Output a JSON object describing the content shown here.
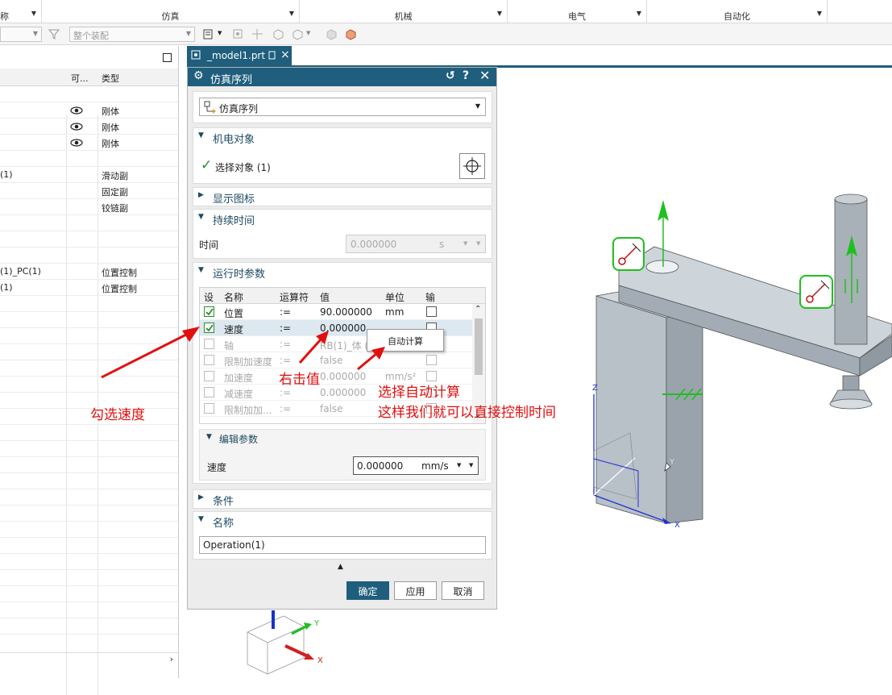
{
  "ribbon": {
    "groups": [
      {
        "label": "仿真"
      },
      {
        "label": "机械"
      },
      {
        "label": "电气"
      },
      {
        "label": "自动化"
      }
    ],
    "left_fragment": "称"
  },
  "toolbar": {
    "combo_left_value": "",
    "assembly_combo": "整个装配"
  },
  "navigator": {
    "columns": [
      "可...",
      "类型"
    ],
    "rows": [
      {
        "name": "",
        "visible": false,
        "type": ""
      },
      {
        "name": "",
        "visible": true,
        "type": "刚体"
      },
      {
        "name": "",
        "visible": true,
        "type": "刚体"
      },
      {
        "name": "",
        "visible": true,
        "type": "刚体"
      },
      {
        "name": "",
        "visible": false,
        "type": ""
      },
      {
        "name": "(1)",
        "visible": false,
        "type": "滑动副"
      },
      {
        "name": "",
        "visible": false,
        "type": "固定副"
      },
      {
        "name": "",
        "visible": false,
        "type": "铰链副"
      },
      {
        "name": "",
        "visible": false,
        "type": ""
      },
      {
        "name": "",
        "visible": false,
        "type": ""
      },
      {
        "name": "",
        "visible": false,
        "type": ""
      },
      {
        "name": "(1)_PC(1)",
        "visible": false,
        "type": "位置控制"
      },
      {
        "name": "(1)",
        "visible": false,
        "type": "位置控制"
      }
    ]
  },
  "tab": {
    "label": "_model1.prt"
  },
  "dialog": {
    "title": "仿真序列",
    "type_select": "仿真序列",
    "sections": {
      "mech_object": "机电对象",
      "show_icon": "显示图标",
      "duration": "持续时间",
      "runtime_params": "运行时参数",
      "edit_params": "编辑参数",
      "conditions": "条件",
      "name": "名称"
    },
    "select_object": "选择对象 (1)",
    "time_label": "时间",
    "time_value": "0.000000",
    "time_unit": "s",
    "grid_headers": [
      "设",
      "名称",
      "运算符",
      "值",
      "单位",
      "输"
    ],
    "grid_rows": [
      {
        "set": true,
        "name": "位置",
        "op": ":=",
        "value": "90.000000",
        "unit": "mm",
        "out": false,
        "enabled": true
      },
      {
        "set": true,
        "name": "速度",
        "op": ":=",
        "value": "0.000000",
        "unit": "",
        "out": false,
        "enabled": true,
        "selected": true
      },
      {
        "set": false,
        "name": "轴",
        "op": ":=",
        "value": "RB(1)_体 (",
        "unit": "",
        "out": false,
        "enabled": false
      },
      {
        "set": false,
        "name": "限制加速度",
        "op": ":=",
        "value": "false",
        "unit": "",
        "out": false,
        "enabled": false
      },
      {
        "set": false,
        "name": "加速度",
        "op": ":=",
        "value": "0.000000",
        "unit": "mm/s²",
        "out": false,
        "enabled": false
      },
      {
        "set": false,
        "name": "减速度",
        "op": ":=",
        "value": "0.000000",
        "unit": "",
        "out": false,
        "enabled": false
      },
      {
        "set": false,
        "name": "限制加加...",
        "op": ":=",
        "value": "false",
        "unit": "",
        "out": false,
        "enabled": false
      }
    ],
    "edit_label": "速度",
    "edit_value": "0.000000",
    "edit_unit": "mm/s",
    "name_value": "Operation(1)",
    "buttons": {
      "ok": "确定",
      "apply": "应用",
      "cancel": "取消"
    }
  },
  "context_menu": {
    "item": "自动计算"
  },
  "annotations": {
    "check_speed": "勾选速度",
    "right_click": "右击值",
    "auto_calc_line1": "选择自动计算",
    "auto_calc_line2": "这样我们就可以直接控制时间"
  },
  "viewport": {
    "axis_labels": {
      "z": "Z",
      "y": "Y",
      "x": "X"
    },
    "triad_labels": {
      "y": "Y",
      "x": "X"
    }
  },
  "colors": {
    "accent": "#1f5e7c",
    "annotation": "#e01010",
    "check": "#2e8b2e",
    "handle_green": "#1fbf1f"
  }
}
